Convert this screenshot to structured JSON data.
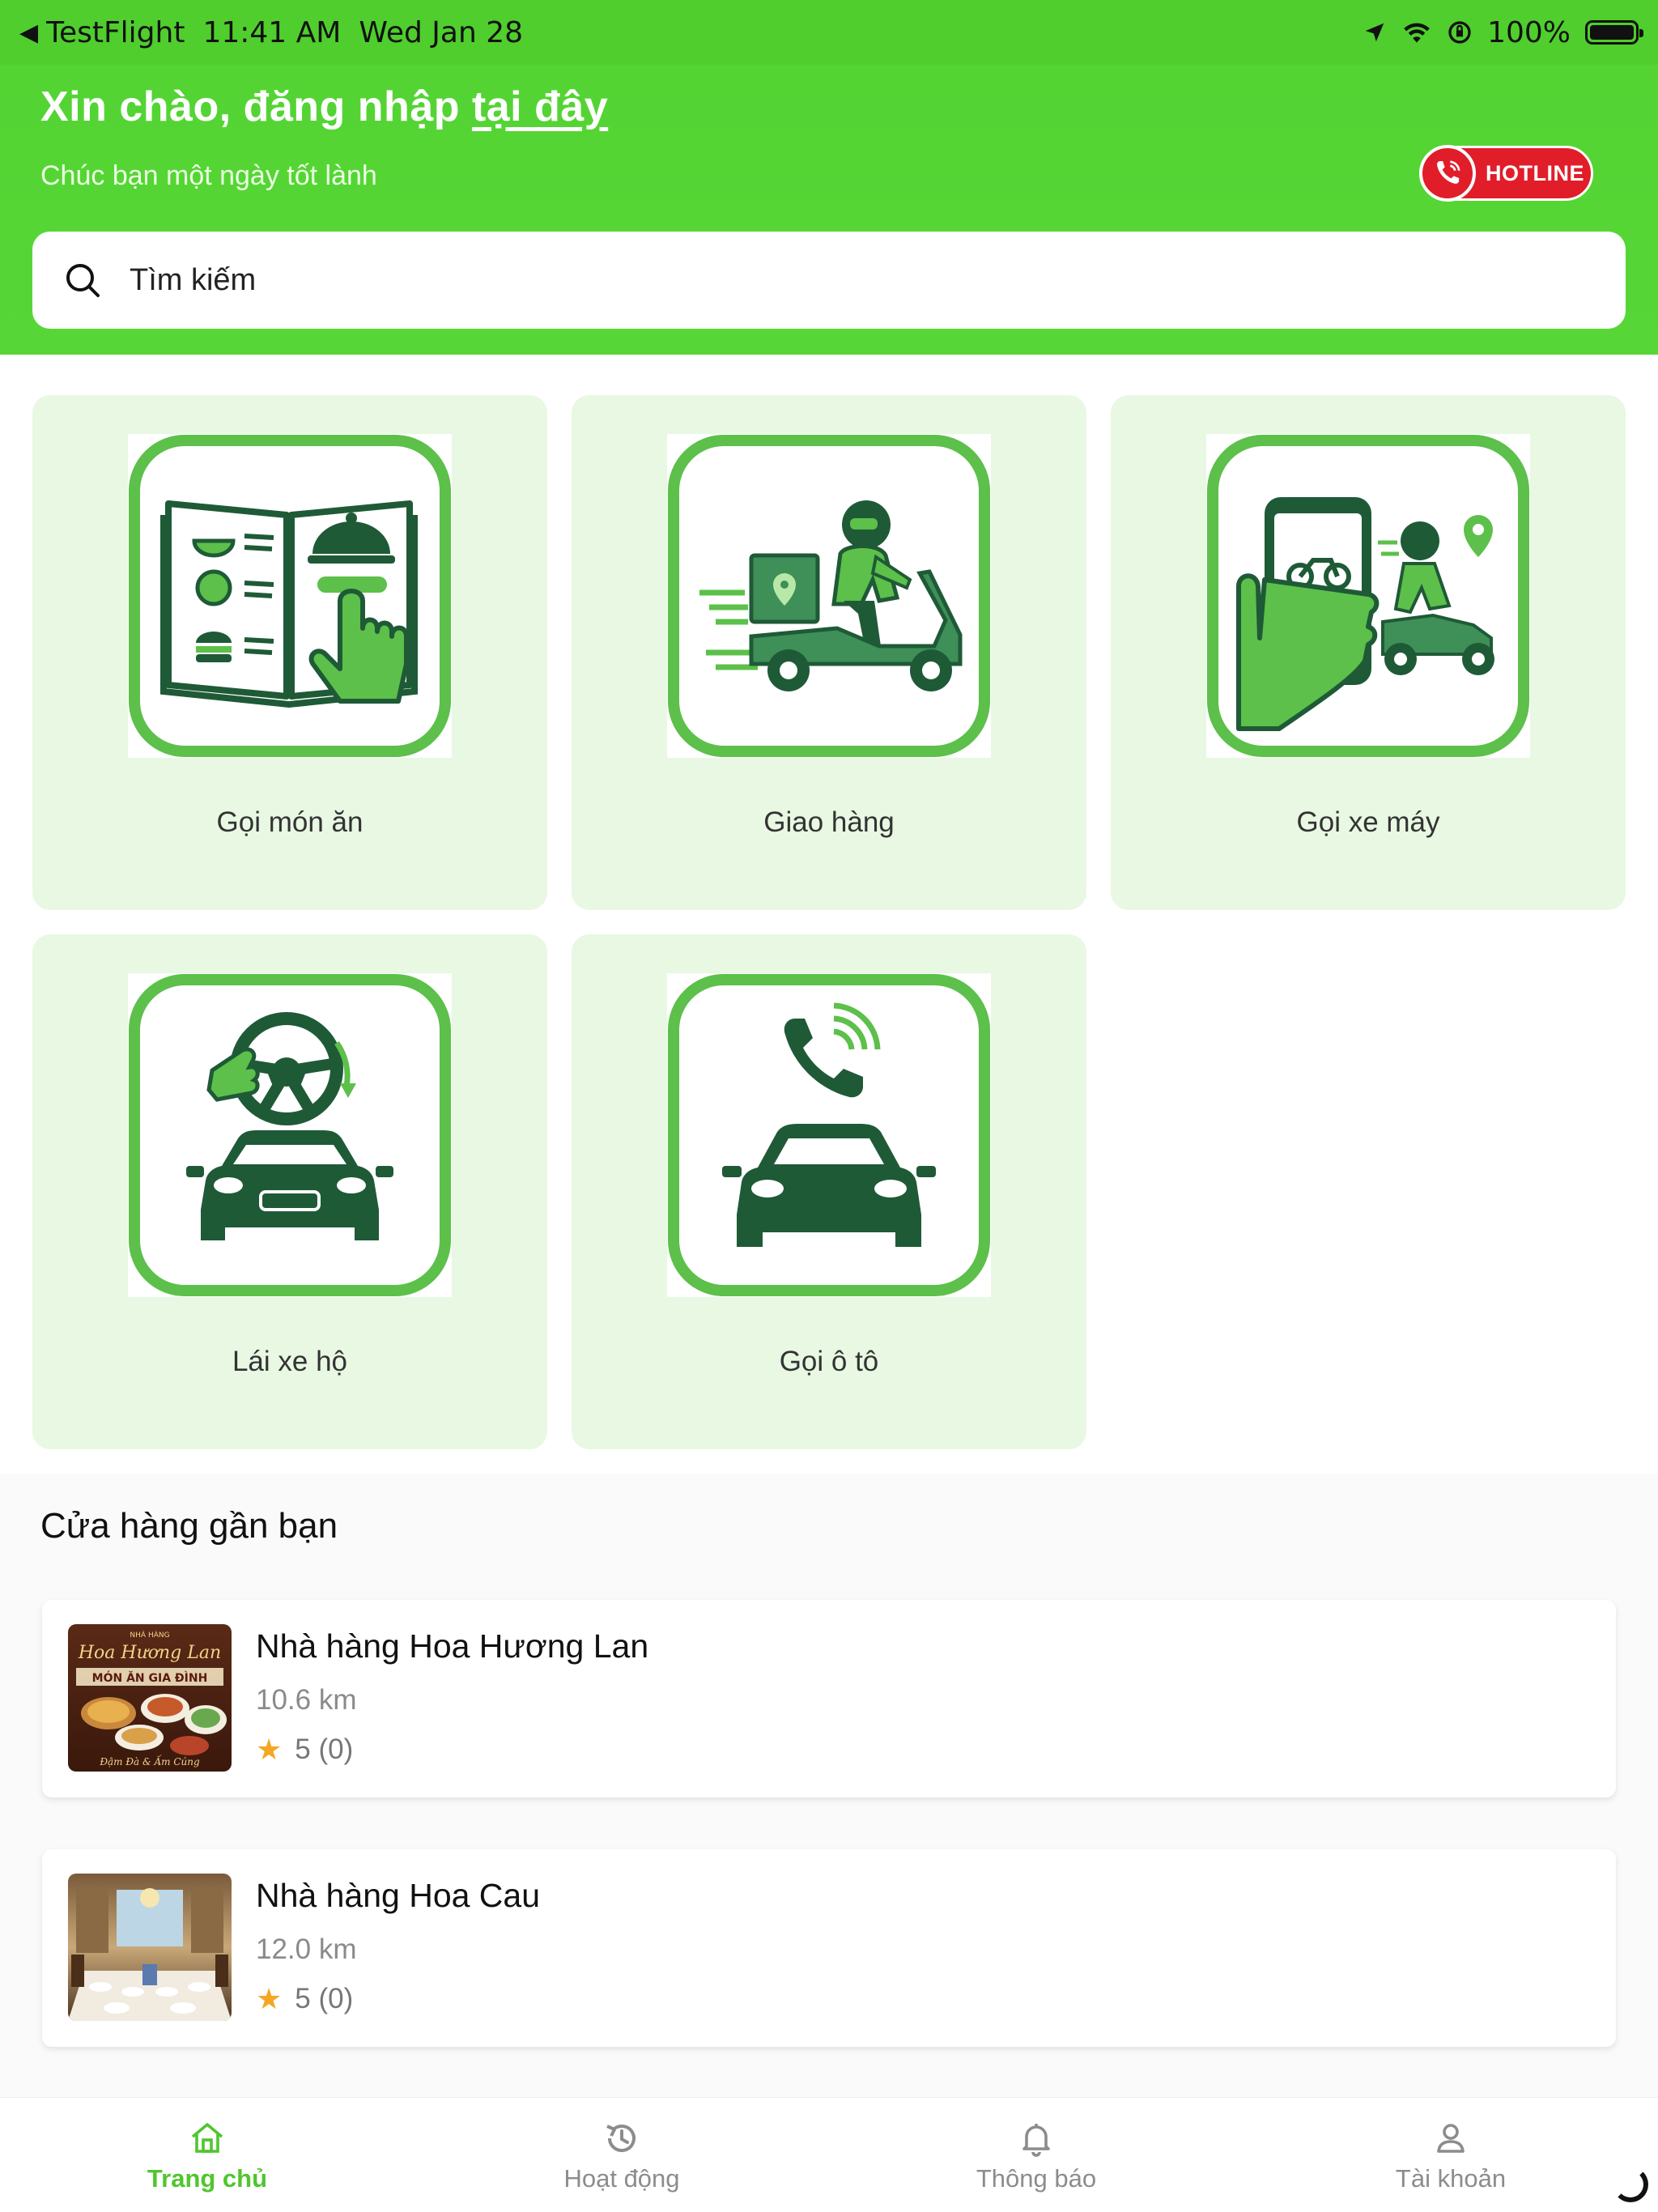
{
  "status_bar": {
    "back_app": "TestFlight",
    "time": "11:41 AM",
    "date": "Wed Jan 28",
    "battery": "100%"
  },
  "header": {
    "greeting_prefix": "Xin chào, đăng nhập",
    "greeting_link": "tại đây",
    "subtitle": "Chúc bạn một ngày tốt lành",
    "hotline_label": "HOTLINE"
  },
  "search": {
    "placeholder": "Tìm kiếm"
  },
  "services": [
    {
      "label": "Gọi món ăn",
      "icon": "food-menu-icon"
    },
    {
      "label": "Giao hàng",
      "icon": "delivery-scooter-icon"
    },
    {
      "label": "Gọi xe máy",
      "icon": "call-bike-icon"
    },
    {
      "label": "Lái xe hộ",
      "icon": "driver-steering-icon"
    },
    {
      "label": "Gọi ô tô",
      "icon": "call-car-icon"
    }
  ],
  "nearby": {
    "title": "Cửa hàng gần bạn",
    "stores": [
      {
        "name": "Nhà hàng Hoa Hương Lan",
        "distance": "10.6 km",
        "rating": "5 (0)",
        "thumb_title": "Hoa Hương Lan",
        "thumb_subtitle": "MÓN ĂN GIA ĐÌNH",
        "thumb_caption": "Đậm Đà & Ấm Cúng",
        "thumb_top": "NHÀ HÀNG"
      },
      {
        "name": "Nhà hàng Hoa Cau",
        "distance": "12.0 km",
        "rating": "5 (0)"
      }
    ]
  },
  "tabs": [
    {
      "label": "Trang chủ",
      "icon": "home-icon",
      "active": true
    },
    {
      "label": "Hoạt động",
      "icon": "history-icon",
      "active": false
    },
    {
      "label": "Thông báo",
      "icon": "bell-icon",
      "active": false
    },
    {
      "label": "Tài khoản",
      "icon": "user-icon",
      "active": false
    }
  ],
  "colors": {
    "brand_green": "#4fce2d",
    "card_bg": "#e8f8e3",
    "icon_dark_green": "#1f5a37",
    "icon_light_green": "#5cc04a",
    "hotline_red": "#e11d2a",
    "star": "#f5a623"
  }
}
